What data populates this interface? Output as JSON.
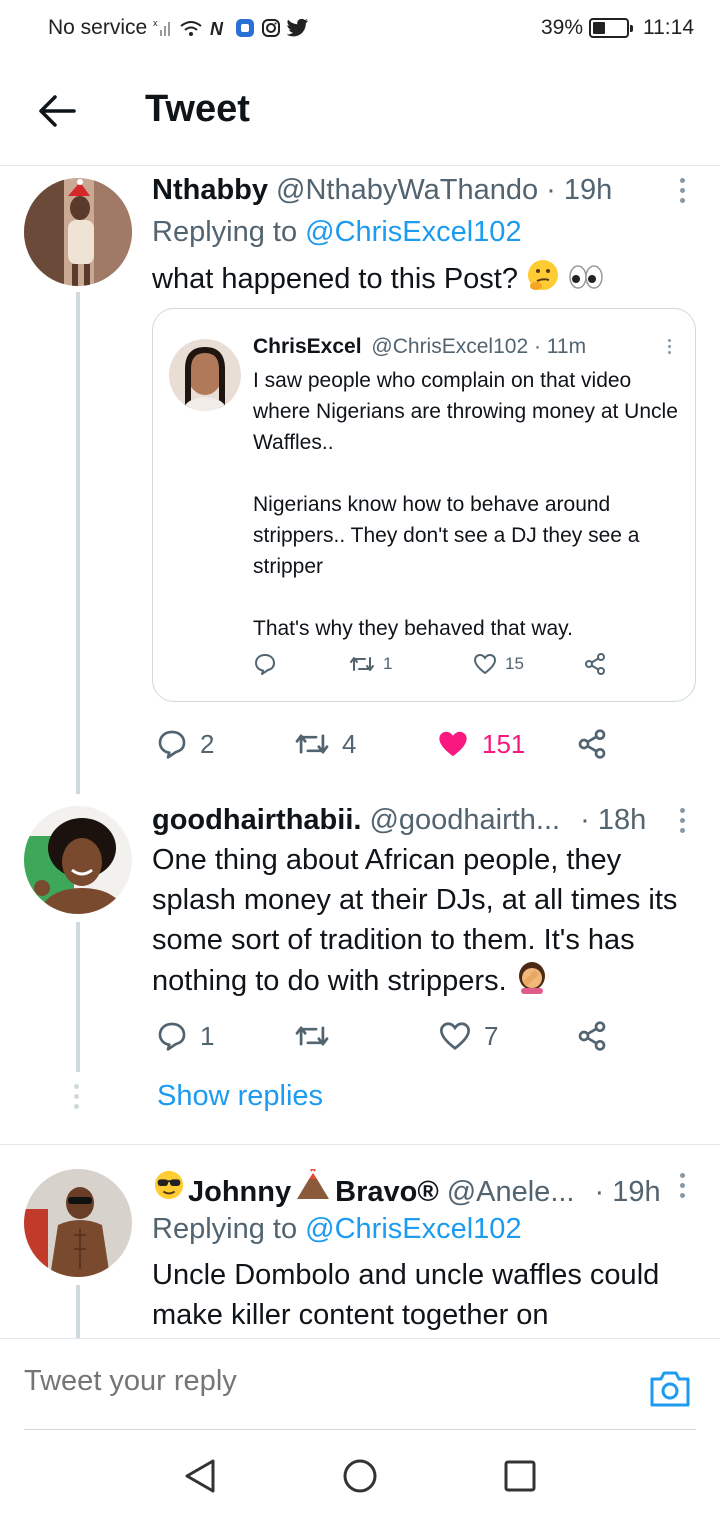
{
  "status_bar": {
    "carrier": "No service",
    "battery": "39%",
    "battery_level": 0.39,
    "time": "11:14"
  },
  "header": {
    "title": "Tweet"
  },
  "tweets": [
    {
      "name": "Nthabby",
      "handle": "@NthabyWaThando",
      "time": "· 19h",
      "replying_prefix": "Replying to",
      "replying_to": "@ChrisExcel102",
      "text": "what happened to this Post?",
      "quote": {
        "name": "ChrisExcel",
        "handle": "@ChrisExcel102",
        "time": "· 11m",
        "text": "I saw people who complain on that video where Nigerians are throwing money at Uncle Waffles..\n\nNigerians know how to behave around strippers.. They don't see a DJ they see a stripper\n\nThat's why they behaved that way.",
        "retweets": "1",
        "likes": "15"
      },
      "replies": "2",
      "retweets": "4",
      "likes": "151"
    },
    {
      "name": "goodhairthabii.",
      "handle": "@goodhairth...",
      "time": "· 18h",
      "text": "One thing about African people, they splash money at their DJs, at all times its some sort of tradition to them. It's has nothing to do with strippers.",
      "replies": "1",
      "retweets": "",
      "likes": "7",
      "show_replies": "Show replies"
    },
    {
      "name_part1": "Johnny",
      "name_part2": "Bravo®",
      "handle": "@Anele...",
      "time": "· 19h",
      "replying_prefix": "Replying to",
      "replying_to": "@ChrisExcel102",
      "text": "Uncle Dombolo and uncle waffles could make killer content together on"
    }
  ],
  "reply_bar": {
    "placeholder": "Tweet your reply"
  },
  "colors": {
    "link": "#1d9bf0",
    "like_active": "#f91880",
    "secondary_text": "#536471"
  }
}
